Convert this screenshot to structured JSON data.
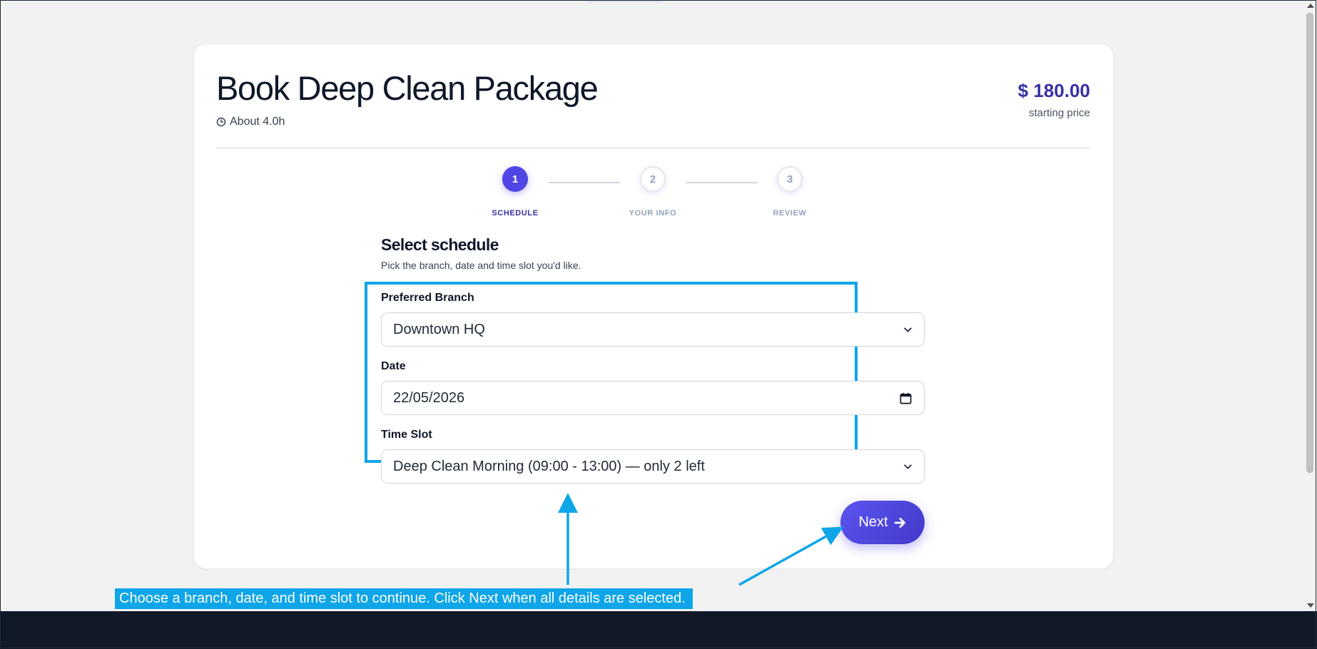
{
  "booking": {
    "title": "Book Deep Clean Package",
    "duration": "About 4.0h",
    "price": "$ 180.00",
    "price_caption": "starting price"
  },
  "stepper": {
    "steps": [
      {
        "number": "1",
        "label": "SCHEDULE",
        "state": "active"
      },
      {
        "number": "2",
        "label": "YOUR INFO",
        "state": "inactive"
      },
      {
        "number": "3",
        "label": "REVIEW",
        "state": "inactive"
      }
    ]
  },
  "schedule": {
    "heading": "Select schedule",
    "subheading": "Pick the branch, date and time slot you'd like.",
    "branch_label": "Preferred Branch",
    "branch_value": "Downtown HQ",
    "date_label": "Date",
    "date_value": "22/05/2026",
    "time_label": "Time Slot",
    "time_value": "Deep Clean Morning (09:00 - 13:00) — only 2 left"
  },
  "actions": {
    "next_label": "Next"
  },
  "annotation": {
    "hint": "Choose a branch, date, and time slot to continue. Click Next when all details are selected."
  },
  "icons": [
    "clock-icon",
    "chevron-down-icon",
    "calendar-icon",
    "arrow-right-icon"
  ],
  "colors": {
    "accent": "#4f46e5",
    "price": "#3730a3",
    "annotation": "#0ea5e9",
    "taskbar": "#111827"
  }
}
